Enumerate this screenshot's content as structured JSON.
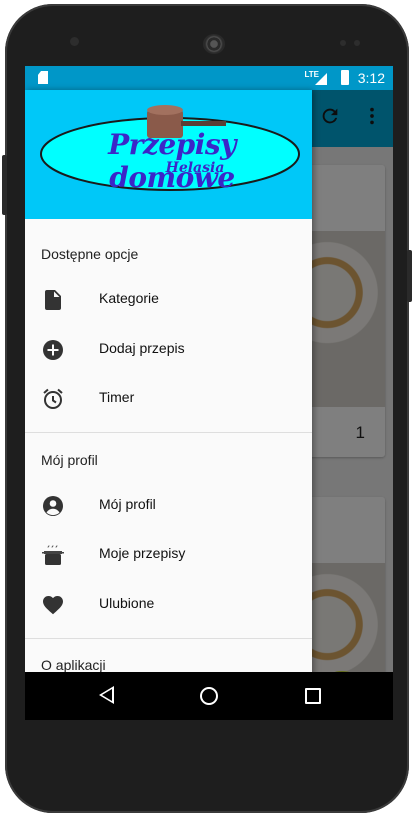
{
  "status_bar": {
    "network": "LTE",
    "time": "3:12"
  },
  "app": {
    "logo_title": "Przepisy domowe",
    "logo_subtitle": "Helasia",
    "card_number": "1"
  },
  "drawer": {
    "sections": [
      {
        "title": "Dostępne opcje",
        "items": [
          {
            "label": "Kategorie",
            "icon": "file-icon"
          },
          {
            "label": "Dodaj przepis",
            "icon": "add-circle-icon"
          },
          {
            "label": "Timer",
            "icon": "alarm-icon"
          }
        ]
      },
      {
        "title": "Mój profil",
        "items": [
          {
            "label": "Mój profil",
            "icon": "account-icon"
          },
          {
            "label": "Moje przepisy",
            "icon": "pot-icon"
          },
          {
            "label": "Ulubione",
            "icon": "heart-icon"
          }
        ]
      },
      {
        "title": "O aplikacji",
        "items": []
      }
    ]
  },
  "colors": {
    "status_bar": "#0097c8",
    "app_bar": "#00a8d8",
    "drawer_header": "#00c8f8",
    "logo_ellipse": "#00ffff",
    "logo_text": "#3b26c8",
    "fab": "#c8d834"
  }
}
